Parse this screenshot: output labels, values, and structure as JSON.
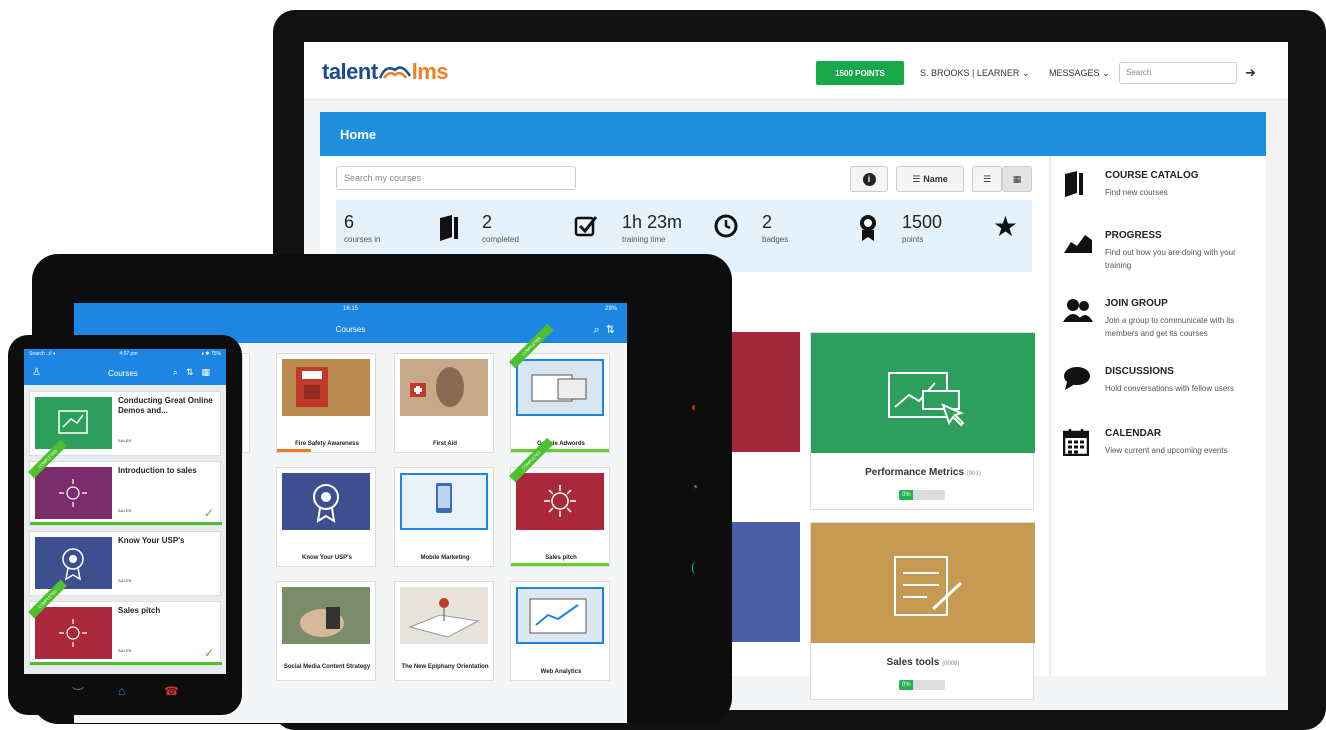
{
  "colors": {
    "brand_blue": "#1f8fde",
    "points_green": "#18a84a",
    "logo_navy": "#1b4a8f",
    "logo_orange": "#ef7d22",
    "completed_green": "#4cc02e"
  },
  "desktop": {
    "logo": {
      "part1": "talent",
      "part2": "lms"
    },
    "header": {
      "points_button": "1500 POINTS",
      "user_menu": "S. BROOKS | LEARNER ⌄",
      "messages_menu": "MESSAGES ⌄",
      "search_placeholder": "Search",
      "logout_icon": "sign-out-icon"
    },
    "home_title": "Home",
    "course_search_placeholder": "Search my courses",
    "toolbar": {
      "sort_label": "Name"
    },
    "stats": [
      {
        "value": "6",
        "label": "courses in",
        "icon": "book-icon"
      },
      {
        "value": "2",
        "label": "completed",
        "icon": "checkbox-icon"
      },
      {
        "value": "1h 23m",
        "label": "training time",
        "icon": "clock-icon"
      },
      {
        "value": "2",
        "label": "badges",
        "icon": "award-icon"
      },
      {
        "value": "1500",
        "label": "points",
        "icon": "star-icon"
      }
    ],
    "cards": [
      {
        "title": "Performance Metrics",
        "code": "(001)",
        "progress_label": "0%",
        "progress": 0.3
      },
      {
        "title": "Sales tools",
        "code": "(0008)",
        "progress_label": "0%",
        "progress": 0.3
      }
    ],
    "sidebar": [
      {
        "title": "COURSE CATALOG",
        "desc": "Find new courses",
        "icon": "book-icon"
      },
      {
        "title": "PROGRESS",
        "desc": "Find out how you are doing with your training",
        "icon": "chart-icon"
      },
      {
        "title": "JOIN GROUP",
        "desc": "Join a group to communicate with its members and get its courses",
        "icon": "users-icon"
      },
      {
        "title": "DISCUSSIONS",
        "desc": "Hold conversations with fellow users",
        "icon": "comment-icon"
      },
      {
        "title": "CALENDAR",
        "desc": "View current and upcoming events",
        "icon": "calendar-icon"
      }
    ]
  },
  "tablet": {
    "time": "16:15",
    "battery": "29%",
    "title": "Courses",
    "courses": [
      {
        "name": "Fire Safety Awareness",
        "completed": false,
        "progress": 0.35
      },
      {
        "name": "First Aid",
        "completed": false,
        "progress": 0
      },
      {
        "name": "Google Adwords",
        "completed": true,
        "progress": 1
      },
      {
        "name": "Know Your USP's",
        "completed": false,
        "progress": 0
      },
      {
        "name": "Mobile Marketing",
        "completed": false,
        "progress": 0
      },
      {
        "name": "Sales pitch",
        "completed": true,
        "progress": 1
      },
      {
        "name": "Social Media Content Strategy",
        "completed": false,
        "progress": 0
      },
      {
        "name": "The New Epiphany Orientation",
        "completed": false,
        "progress": 0
      },
      {
        "name": "Web Analytics",
        "completed": false,
        "progress": 0
      }
    ],
    "ribbon_label": "COMPLETED"
  },
  "phone": {
    "carrier": "Search ..ıl ♦",
    "time": "4:07 pm",
    "battery": "♦ ✱ 75%",
    "title": "Courses",
    "courses": [
      {
        "title": "Conducting Great Online Demos and...",
        "category": "SALES",
        "completed": false
      },
      {
        "title": "Introduction to sales",
        "category": "SALES",
        "completed": true
      },
      {
        "title": "Know Your USP's",
        "category": "SALES",
        "completed": false
      },
      {
        "title": "Sales pitch",
        "category": "SALES",
        "completed": true
      }
    ]
  }
}
